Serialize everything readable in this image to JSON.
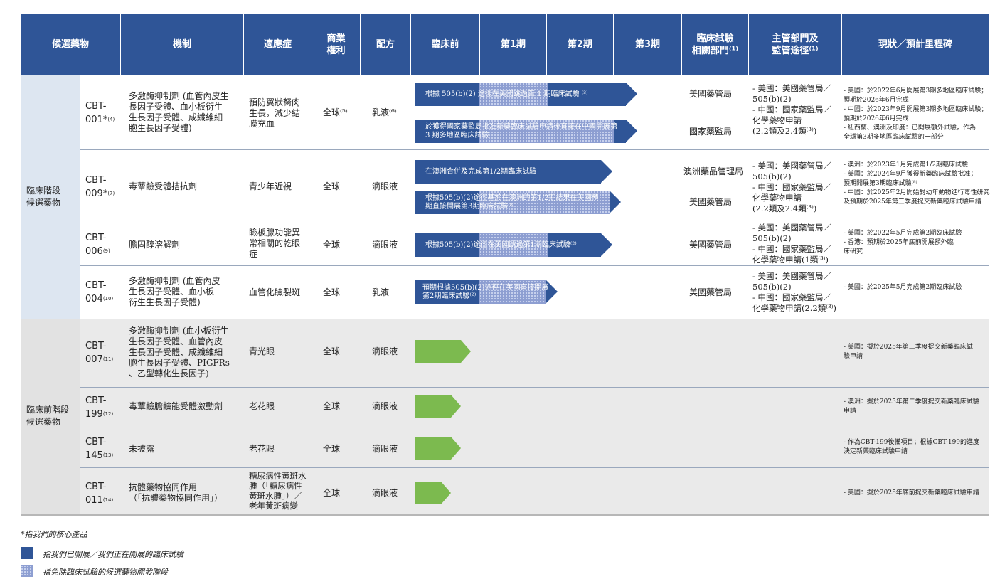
{
  "headers": [
    "候選藥物",
    "機制",
    "適應症",
    "商業\n權利",
    "配方",
    "臨床前",
    "第1期",
    "第2期",
    "第3期",
    "臨床試驗\n相關部門⁽¹⁾",
    "主管部門及\n監管途徑⁽¹⁾",
    "現狀／預計里程碑"
  ],
  "stages": {
    "clinical": "臨床階段\n候選藥物",
    "preclinical": "臨床前階段\n候選藥物"
  },
  "rows": [
    {
      "code": "CBT-\n001*",
      "note": "(4)",
      "mechanism": "多激酶抑制劑 (血管內皮生\n長因子受體、血小板衍生\n生長因子受體、成纖維細\n胞生長因子受體)",
      "indication": "預防翼狀胬肉\n生長，減少結\n膜充血",
      "rights": "全球⁽⁵⁾",
      "formulation": "乳液⁽⁶⁾",
      "arrows": [
        "根據 505(b)(2) 途徑在美國跳過第 1 期臨床試驗 ⁽²⁾",
        "於獲得國家藥監局批准新藥臨床試驗申請後直接在中國開展第\n3 期多地區臨床試驗"
      ],
      "departments": [
        "美國藥管局",
        "國家藥監局"
      ],
      "regulatory": "- 美國：美國藥管局／\n  505(b)(2)\n- 中國：國家藥監局／\n  化學藥物申請\n  (2.2類及2.4類⁽³⁾)",
      "status": "- 美國：於2022年6月開展第3期多地區臨床試驗；\n  預期於2026年6月完成\n- 中國：於2023年9月開展第3期多地區臨床試驗；\n  預期於2026年6月完成\n- 紐西蘭、澳洲及印度：已開展額外試驗，作為\n  全球第3期多地區臨床試驗的一部分"
    },
    {
      "code": "CBT-\n009*",
      "note": "(7)",
      "mechanism": "毒蕈鹼受體拮抗劑",
      "indication": "青少年近視",
      "rights": "全球",
      "formulation": "滴眼液",
      "arrows": [
        "在澳洲合併及完成第1/2期臨床試驗",
        "根據505(b)(2)途徑基於在澳洲的第1/2期結果在美國預\n期直接開展第3期臨床試驗⁽⁸⁾"
      ],
      "departments": [
        "澳洲藥品管理局",
        "美國藥管局"
      ],
      "regulatory": "- 美國：美國藥管局／\n  505(b)(2)\n- 中國：國家藥監局／\n  化學藥物申請\n  (2.2類及2.4類⁽³⁾)",
      "status": "- 澳洲：於2023年1月完成第1/2期臨床試驗\n- 美國：於2024年9月獲得新藥臨床試驗批准；\n  預期開展第3期臨床試驗⁽⁸⁾\n- 中國：於2025年2月開始對幼年動物進行毒性研究\n  及預期於2025年第三季度提交新藥臨床試驗申請"
    },
    {
      "code": "CBT-\n006",
      "note": "(9)",
      "mechanism": "膽固醇溶解劑",
      "indication": "瞼板腺功能異\n常相關的乾眼\n症",
      "rights": "全球",
      "formulation": "滴眼液",
      "arrows": [
        "根據505(b)(2)途徑在美國跳過第1期臨床試驗⁽²⁾"
      ],
      "departments": [
        "美國藥管局"
      ],
      "regulatory": "- 美國：美國藥管局／\n  505(b)(2)\n- 中國：國家藥監局／\n  化學藥物申請(1類⁽³⁾)",
      "status": "- 美國：於2022年5月完成第2期臨床試驗\n- 香港：預期於2025年底前開展額外臨\n  床研究"
    },
    {
      "code": "CBT-\n004",
      "note": "(10)",
      "mechanism": "多激酶抑制劑 (血管內皮\n生長因子受體、血小板\n衍生生長因子受體)",
      "indication": "血管化瞼裂斑",
      "rights": "全球",
      "formulation": "乳液",
      "arrows": [
        "預期根據505(b)(2)途徑在美國直接開展\n第2期臨床試驗⁽²⁾"
      ],
      "departments": [
        "美國藥管局"
      ],
      "regulatory": "- 美國：美國藥管局／\n  505(b)(2)\n- 中國：國家藥監局／\n  化學藥物申請(2.2類⁽³⁾)",
      "status": "- 美國：於2025年5月完成第2期臨床試驗"
    },
    {
      "code": "CBT-\n007",
      "note": "(11)",
      "mechanism": "多激酶抑制劑 (血小板衍生\n生長因子受體、血管內皮\n生長因子受體、成纖維細\n胞生長因子受體、PIGFRs\n、乙型轉化生長因子)",
      "indication": "青光眼",
      "rights": "全球",
      "formulation": "滴眼液",
      "status": "- 美國：擬於2025年第三季度提交新藥臨床試\n  驗申請"
    },
    {
      "code": "CBT-\n199",
      "note": "(12)",
      "mechanism": "毒蕈鹼膽鹼能受體激動劑",
      "indication": "老花眼",
      "rights": "全球",
      "formulation": "滴眼液",
      "status": "- 澳洲：擬於2025年第二季度提交新藥臨床試驗\n  申請"
    },
    {
      "code": "CBT-\n145",
      "note": "(13)",
      "mechanism": "未披露",
      "indication": "老花眼",
      "rights": "全球",
      "formulation": "滴眼液",
      "status": "- 作為CBT-199後備項目；根據CBT-199的進度\n  決定新藥臨床試驗申請"
    },
    {
      "code": "CBT-\n011",
      "note": "(14)",
      "mechanism": "抗體藥物協同作用\n（「抗體藥物協同作用」）",
      "indication": "糖尿病性黃斑水\n腫（「糖尿病性\n黃斑水腫」）／\n老年黃斑病變",
      "rights": "全球",
      "formulation": "滴眼液",
      "status": "- 美國：擬於2025年底前提交新藥臨床試驗申請"
    }
  ],
  "legend": {
    "footnote": "*指我們的核心產品",
    "solid": "指我們已開展／我們正在開展的臨床試驗",
    "dotted": "指免除臨床試驗的候選藥物開發階段"
  }
}
